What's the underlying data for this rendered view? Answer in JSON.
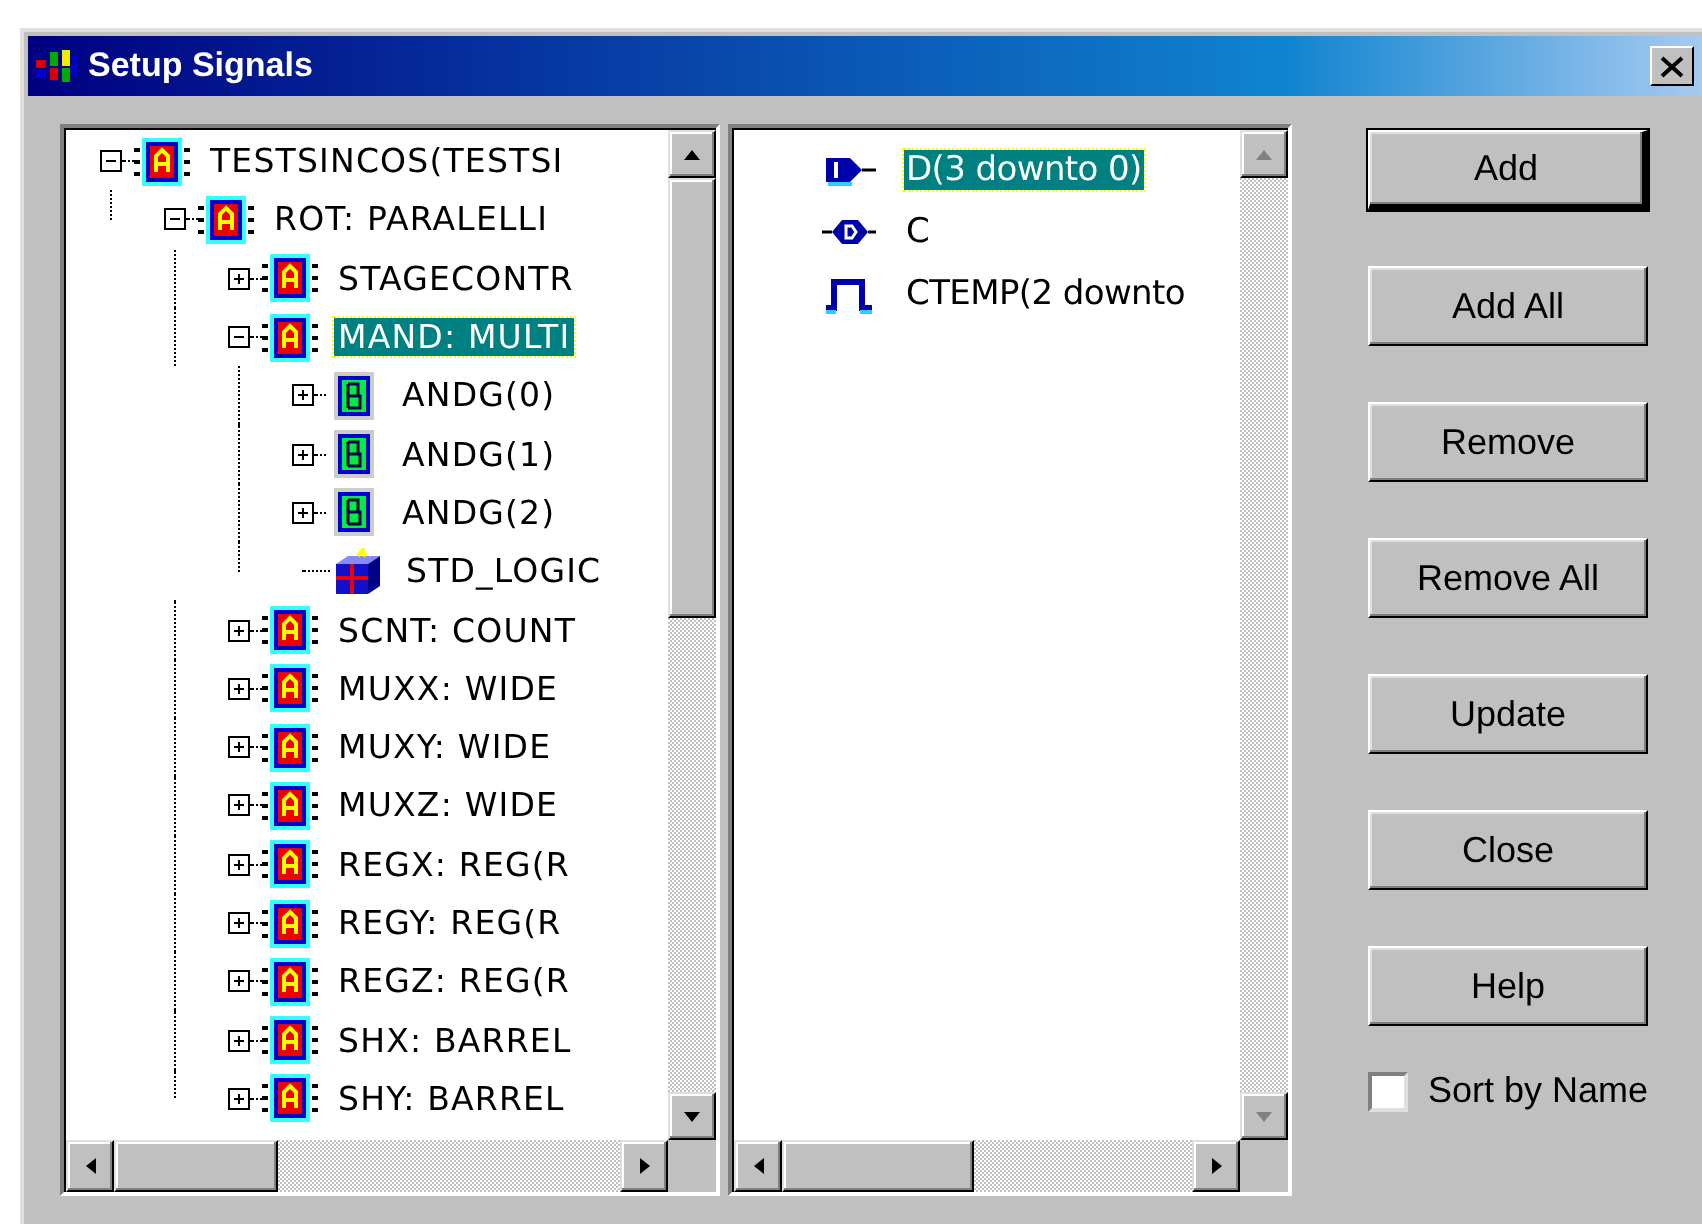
{
  "window": {
    "title": "Setup Signals"
  },
  "tree": [
    {
      "label": "TESTSINCOS(TESTSI",
      "kind": "block-a",
      "expanded": true,
      "selected": false,
      "children": [
        {
          "label": "ROT:  PARALELLI",
          "kind": "block-a",
          "expanded": true,
          "selected": false,
          "children": [
            {
              "label": "STAGECONTR",
              "kind": "block-a",
              "expanded": false,
              "selected": false
            },
            {
              "label": "MAND:  MULTI",
              "kind": "block-a",
              "expanded": true,
              "selected": true,
              "children": [
                {
                  "label": "ANDG(0)",
                  "kind": "block-b",
                  "expanded": false,
                  "selected": false
                },
                {
                  "label": "ANDG(1)",
                  "kind": "block-b",
                  "expanded": false,
                  "selected": false
                },
                {
                  "label": "ANDG(2)",
                  "kind": "block-b",
                  "expanded": false,
                  "selected": false
                },
                {
                  "label": "STD_LOGIC",
                  "kind": "package",
                  "selected": false
                }
              ]
            },
            {
              "label": "SCNT:  COUNT",
              "kind": "block-a",
              "expanded": false,
              "selected": false
            },
            {
              "label": "MUXX:  WIDE",
              "kind": "block-a",
              "expanded": false,
              "selected": false
            },
            {
              "label": "MUXY:  WIDE",
              "kind": "block-a",
              "expanded": false,
              "selected": false
            },
            {
              "label": "MUXZ:  WIDE",
              "kind": "block-a",
              "expanded": false,
              "selected": false
            },
            {
              "label": "REGX:  REG(R",
              "kind": "block-a",
              "expanded": false,
              "selected": false
            },
            {
              "label": "REGY:  REG(R",
              "kind": "block-a",
              "expanded": false,
              "selected": false
            },
            {
              "label": "REGZ:  REG(R",
              "kind": "block-a",
              "expanded": false,
              "selected": false
            },
            {
              "label": "SHX:  BARREL",
              "kind": "block-a",
              "expanded": false,
              "selected": false
            },
            {
              "label": "SHY:  BARREL",
              "kind": "block-a",
              "expanded": false,
              "selected": false
            }
          ]
        }
      ]
    }
  ],
  "signals": [
    {
      "label": "D(3 downto 0)",
      "kind": "input-port",
      "selected": true
    },
    {
      "label": "C",
      "kind": "inout-port",
      "selected": false
    },
    {
      "label": "CTEMP(2 downto",
      "kind": "signal",
      "selected": false
    }
  ],
  "buttons": [
    {
      "label": "Add",
      "default": true
    },
    {
      "label": "Add All",
      "default": false
    },
    {
      "label": "Remove",
      "default": false
    },
    {
      "label": "Remove All",
      "default": false
    },
    {
      "label": "Update",
      "default": false
    },
    {
      "label": "Close",
      "default": false
    },
    {
      "label": "Help",
      "default": false
    }
  ],
  "sort_by_name": {
    "label": "Sort by Name",
    "checked": false
  }
}
